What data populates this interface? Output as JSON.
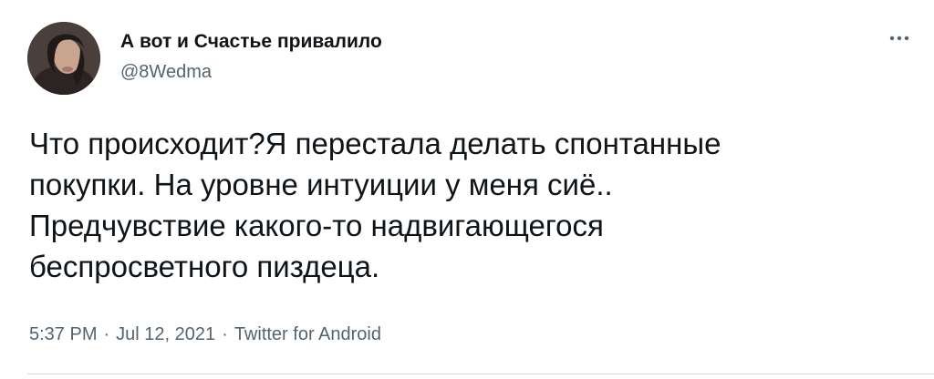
{
  "author": {
    "display_name": "А вот и Счастье привалило",
    "handle": "@8Wedma"
  },
  "tweet": {
    "text": "Что происходит?Я перестала делать спонтанные\nпокупки. На уровне интуиции у меня сиё..\nПредчувствие какого-то надвигающегося\nбеспросветного пиздеца."
  },
  "meta": {
    "time": "5:37 PM",
    "separator": "·",
    "date": "Jul 12, 2021",
    "source": "Twitter for Android"
  },
  "icons": {
    "more": "more-horizontal-icon",
    "avatar": "profile-photo"
  },
  "colors": {
    "text_primary": "#0f1419",
    "text_secondary": "#536471",
    "divider": "#cfd9de"
  }
}
